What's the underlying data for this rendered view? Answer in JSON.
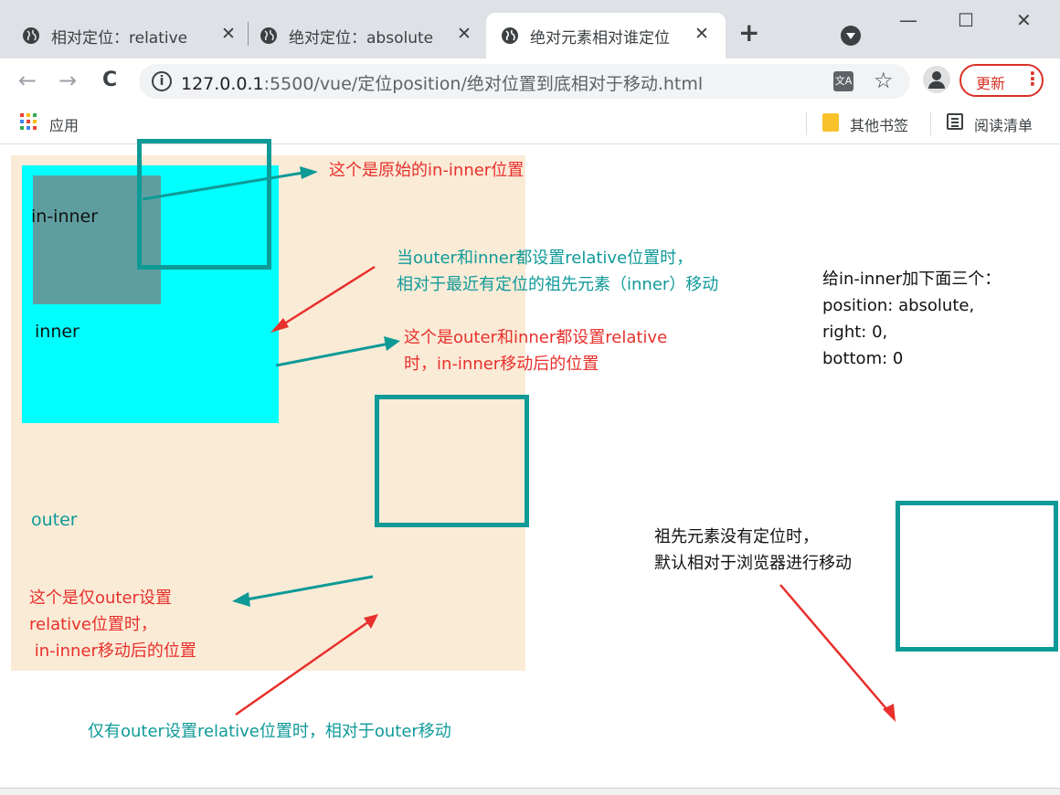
{
  "tabs": [
    {
      "title": "相对定位：relative",
      "close": "✕"
    },
    {
      "title": "绝对定位：absolute",
      "close": "✕"
    },
    {
      "title": "绝对元素相对谁定位",
      "close": "✕"
    }
  ],
  "new_tab": "+",
  "window_controls": {
    "minimize": "—",
    "maximize": "☐",
    "close": "✕"
  },
  "toolbar": {
    "back": "←",
    "forward": "→",
    "reload": "C",
    "info": "i",
    "url_host": "127.0.0.1",
    "url_path": ":5500/vue/定位position/绝对位置到底相对于移动.html",
    "star": "☆",
    "update_label": "更新",
    "menu": "⋮"
  },
  "bookmarks": {
    "apps_label": "应用",
    "other_label": "其他书签",
    "reading_label": "阅读清单"
  },
  "page": {
    "in_inner_label": "in-inner",
    "inner_label": "inner",
    "outer_label": "outer",
    "note_original": "这个是原始的in-inner位置",
    "note_both_relative_1": "当outer和inner都设置relative位置时，",
    "note_both_relative_2": "相对于最近有定位的祖先元素（inner）移动",
    "note_both_moved_1": "这个是outer和inner都设置relative",
    "note_both_moved_2": "时，in-inner移动后的位置",
    "note_add_1": "给in-inner加下面三个：",
    "note_add_2": "position: absolute,",
    "note_add_3": "right: 0,",
    "note_add_4": "bottom: 0",
    "note_outer_only_1": "这个是仅outer设置",
    "note_outer_only_2": "relative位置时，",
    "note_outer_only_3": " in-inner移动后的位置",
    "note_outer_relative": "仅有outer设置relative位置时，相对于outer移动",
    "note_no_position_1": "祖先元素没有定位时，",
    "note_no_position_2": "默认相对于浏览器进行移动"
  },
  "colors": {
    "outer": "#faebd7",
    "inner": "#00ffff",
    "in_inner": "#5f9ea0",
    "frame": "#0e9a96",
    "annotation_red": "#e8302c",
    "annotation_teal": "#109a99",
    "update_red": "#d93025"
  },
  "icons": [
    "globe-icon",
    "profile-icon",
    "info-icon",
    "translate-icon",
    "star-icon",
    "avatar-icon",
    "apps-icon",
    "folder-icon",
    "reading-list-icon"
  ]
}
